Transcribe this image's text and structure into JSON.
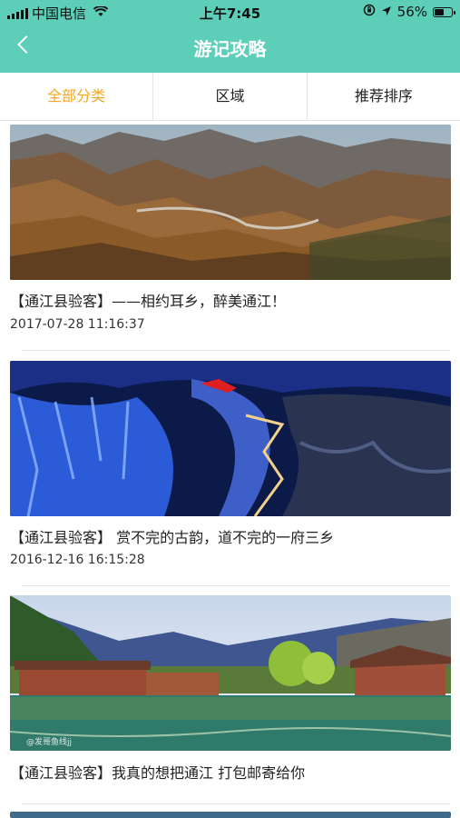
{
  "status": {
    "carrier": "中国电信",
    "time": "上午7:45",
    "battery_percent": "56%",
    "battery_level": 0.56
  },
  "nav": {
    "title": "游记攻略",
    "back_icon": "chevron-left-icon"
  },
  "tabs": [
    {
      "label": "全部分类",
      "active": true
    },
    {
      "label": "区域",
      "active": false
    },
    {
      "label": "推荐排序",
      "active": false
    }
  ],
  "colors": {
    "header": "#5dcfb9",
    "tab_active": "#f5a623"
  },
  "articles": [
    {
      "title": "【通江县验客】——相约耳乡，醉美通江！",
      "date": "2017-07-28 11:16:37"
    },
    {
      "title": "【通江县验客】 赏不完的古韵，道不完的一府三乡",
      "date": "2016-12-16 16:15:28"
    },
    {
      "title": "【通江县验客】我真的想把通江 打包邮寄给你",
      "date": ""
    }
  ]
}
